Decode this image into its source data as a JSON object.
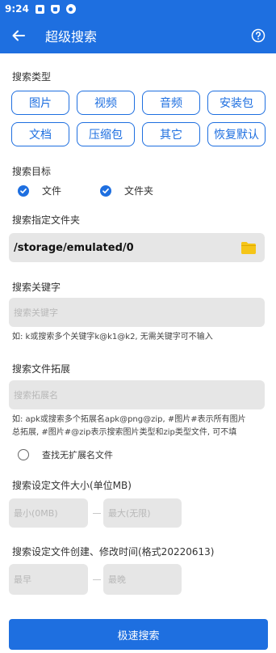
{
  "status": {
    "time": "9:24"
  },
  "appbar": {
    "title": "超级搜索"
  },
  "type_section": {
    "label": "搜索类型",
    "chips": [
      "图片",
      "视频",
      "音频",
      "安装包",
      "文档",
      "压缩包",
      "其它",
      "恢复默认"
    ]
  },
  "target": {
    "label": "搜索目标",
    "file": "文件",
    "folder": "文件夹"
  },
  "folder_section": {
    "label": "搜索指定文件夹",
    "path": "/storage/emulated/0"
  },
  "keyword": {
    "label": "搜索关键字",
    "placeholder": "搜索关键字",
    "hint": "如: k或搜索多个关键字k@k1@k2, 无需关键字可不输入"
  },
  "ext": {
    "label": "搜索文件拓展",
    "placeholder": "搜索拓展名",
    "hint1": "如: apk或搜索多个拓展名apk@png@zip, #图片#表示所有图片",
    "hint2": "总拓展, #图片#@zip表示搜索图片类型和zip类型文件, 可不填",
    "noext": "查找无扩展名文件"
  },
  "size": {
    "label": "搜索设定文件大小(单位MB)",
    "min": "最小(0MB)",
    "max": "最大(无限)"
  },
  "time": {
    "label": "搜索设定文件创建、修改时间(格式20220613)",
    "from": "最早",
    "to": "最晚"
  },
  "action": {
    "search": "极速搜索"
  },
  "colors": {
    "primary": "#1e6fe0",
    "field": "#e6e6e6",
    "folder": "#f5c518"
  }
}
